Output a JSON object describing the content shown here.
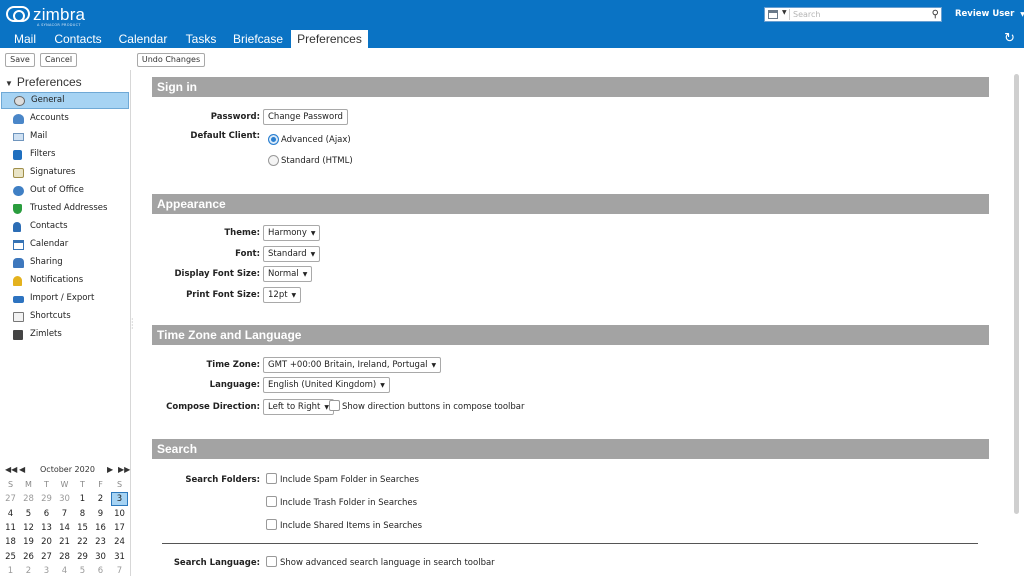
{
  "app": {
    "logo_text": "zimbra",
    "logo_tagline": "A SYNACOR PRODUCT",
    "search_placeholder": "Search",
    "user_label": "Review User"
  },
  "tabs": [
    {
      "label": "Mail"
    },
    {
      "label": "Contacts"
    },
    {
      "label": "Calendar"
    },
    {
      "label": "Tasks"
    },
    {
      "label": "Briefcase"
    },
    {
      "label": "Preferences",
      "active": true
    }
  ],
  "toolbar": {
    "save_label": "Save",
    "cancel_label": "Cancel",
    "undo_label": "Undo Changes"
  },
  "sidebar": {
    "title": "Preferences",
    "items": [
      {
        "label": "General",
        "icon": "gear-icon",
        "selected": true
      },
      {
        "label": "Accounts",
        "icon": "accounts-icon"
      },
      {
        "label": "Mail",
        "icon": "mail-icon"
      },
      {
        "label": "Filters",
        "icon": "filter-icon"
      },
      {
        "label": "Signatures",
        "icon": "signature-icon"
      },
      {
        "label": "Out of Office",
        "icon": "out-of-office-icon"
      },
      {
        "label": "Trusted Addresses",
        "icon": "shield-icon"
      },
      {
        "label": "Contacts",
        "icon": "contacts-icon"
      },
      {
        "label": "Calendar",
        "icon": "calendar-icon"
      },
      {
        "label": "Sharing",
        "icon": "sharing-icon"
      },
      {
        "label": "Notifications",
        "icon": "bell-icon"
      },
      {
        "label": "Import / Export",
        "icon": "import-export-icon"
      },
      {
        "label": "Shortcuts",
        "icon": "shortcuts-icon"
      },
      {
        "label": "Zimlets",
        "icon": "zimlets-icon"
      }
    ]
  },
  "mini_calendar": {
    "month": "October 2020",
    "weekdays": [
      "S",
      "M",
      "T",
      "W",
      "T",
      "F",
      "S"
    ],
    "weeks": [
      [
        "27",
        "28",
        "29",
        "30",
        "1",
        "2",
        "3"
      ],
      [
        "4",
        "5",
        "6",
        "7",
        "8",
        "9",
        "10"
      ],
      [
        "11",
        "12",
        "13",
        "14",
        "15",
        "16",
        "17"
      ],
      [
        "18",
        "19",
        "20",
        "21",
        "22",
        "23",
        "24"
      ],
      [
        "25",
        "26",
        "27",
        "28",
        "29",
        "30",
        "31"
      ],
      [
        "1",
        "2",
        "3",
        "4",
        "5",
        "6",
        "7"
      ]
    ],
    "today": "3"
  },
  "sign_in": {
    "title": "Sign in",
    "password_label": "Password:",
    "change_password_label": "Change Password",
    "default_client_label": "Default Client:",
    "client_options": [
      "Advanced (Ajax)",
      "Standard (HTML)"
    ],
    "client_selected": "Advanced (Ajax)"
  },
  "appearance": {
    "title": "Appearance",
    "theme_label": "Theme:",
    "theme_value": "Harmony",
    "font_label": "Font:",
    "font_value": "Standard",
    "display_font_size_label": "Display Font Size:",
    "display_font_size_value": "Normal",
    "print_font_size_label": "Print Font Size:",
    "print_font_size_value": "12pt"
  },
  "time_zone": {
    "title": "Time Zone and Language",
    "time_zone_label": "Time Zone:",
    "time_zone_value": "GMT +00:00 Britain, Ireland, Portugal",
    "language_label": "Language:",
    "language_value": "English (United Kingdom)",
    "compose_direction_label": "Compose Direction:",
    "compose_direction_value": "Left to Right",
    "show_direction_buttons_label": "Show direction buttons in compose toolbar"
  },
  "search": {
    "title": "Search",
    "search_folders_label": "Search Folders:",
    "include_spam_label": "Include Spam Folder in Searches",
    "include_trash_label": "Include Trash Folder in Searches",
    "include_shared_label": "Include Shared Items in Searches",
    "search_language_label": "Search Language:",
    "show_advanced_label": "Show advanced search language in search toolbar"
  }
}
